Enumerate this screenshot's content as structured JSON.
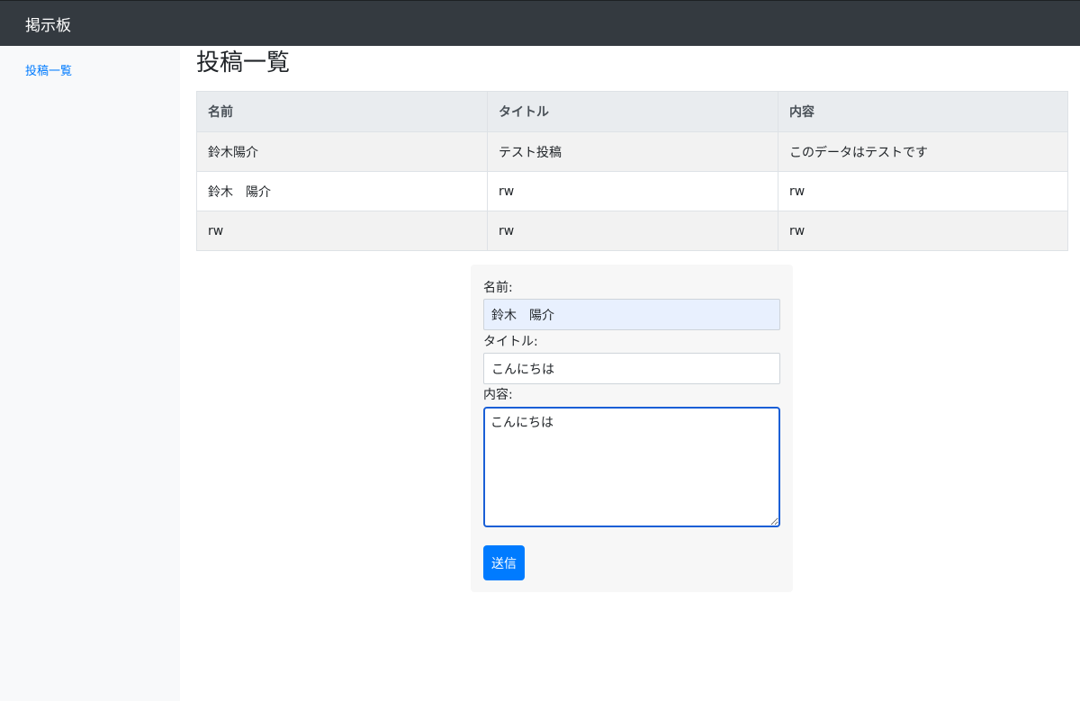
{
  "navbar": {
    "brand": "掲示板"
  },
  "sidebar": {
    "items": [
      {
        "label": "投稿一覧"
      }
    ]
  },
  "main": {
    "title": "投稿一覧",
    "table": {
      "headers": [
        "名前",
        "タイトル",
        "内容"
      ],
      "rows": [
        [
          "鈴木陽介",
          "テスト投稿",
          "このデータはテストです"
        ],
        [
          "鈴木　陽介",
          "rw",
          "rw"
        ],
        [
          "rw",
          "rw",
          "rw"
        ]
      ]
    }
  },
  "form": {
    "name_label": "名前:",
    "name_value": "鈴木　陽介",
    "title_label": "タイトル:",
    "title_value": "こんにちは",
    "content_label": "内容:",
    "content_value": "こんにちは",
    "submit_label": "送信"
  },
  "colors": {
    "navbar_bg": "#343a40",
    "link": "#007bff",
    "primary_button": "#007bff",
    "focus_border": "#1a5fd6",
    "autofill_bg": "#e8f0fe"
  }
}
